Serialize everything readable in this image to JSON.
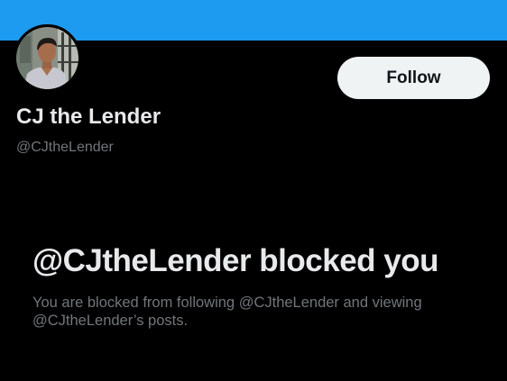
{
  "colors": {
    "banner": "#1d9bf0",
    "background": "#000000",
    "primary_text": "#e7e9ea",
    "secondary_text": "#71767b",
    "button_bg": "#eff3f4",
    "button_text": "#0f1419"
  },
  "profile": {
    "avatar_icon": "profile-photo",
    "display_name": "CJ the Lender",
    "handle": "@CJtheLender"
  },
  "actions": {
    "follow_label": "Follow"
  },
  "blocked": {
    "title": "@CJtheLender blocked you",
    "description": "You are blocked from following @CJtheLender and viewing @CJtheLender’s posts."
  }
}
